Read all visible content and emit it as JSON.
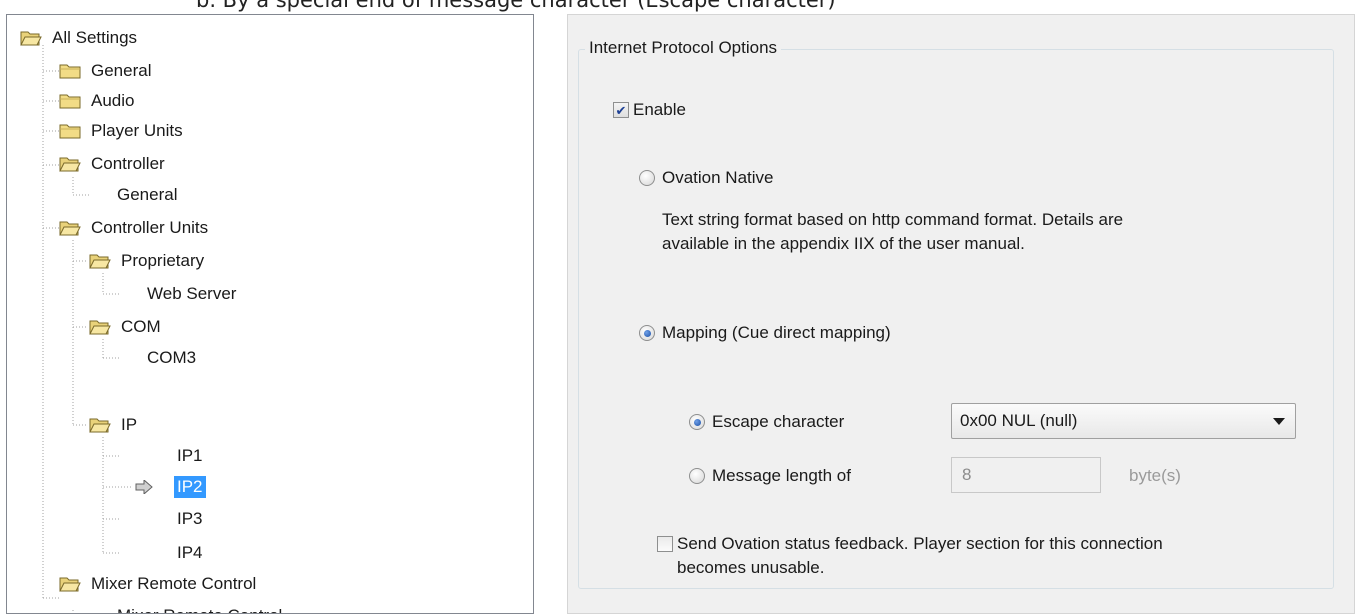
{
  "doc_heading": "b.   By a special end of message character (Escape character)",
  "tree": {
    "items": [
      {
        "label": "All Settings",
        "icon": "folder-open-icon"
      },
      {
        "label": "General",
        "icon": "folder-icon"
      },
      {
        "label": "Audio",
        "icon": "folder-icon"
      },
      {
        "label": "Player Units",
        "icon": "folder-icon"
      },
      {
        "label": "Controller",
        "icon": "folder-open-icon"
      },
      {
        "label": "General",
        "icon": "none"
      },
      {
        "label": "Controller Units",
        "icon": "folder-open-icon"
      },
      {
        "label": "Proprietary",
        "icon": "folder-open-icon"
      },
      {
        "label": "Web Server",
        "icon": "none"
      },
      {
        "label": "COM",
        "icon": "folder-open-icon"
      },
      {
        "label": "COM3",
        "icon": "none"
      },
      {
        "label": "IP",
        "icon": "folder-open-icon"
      },
      {
        "label": "IP1",
        "icon": "none"
      },
      {
        "label": "IP2",
        "icon": "none",
        "selected": true
      },
      {
        "label": "IP3",
        "icon": "none"
      },
      {
        "label": "IP4",
        "icon": "none"
      },
      {
        "label": "Mixer Remote Control",
        "icon": "folder-open-icon"
      },
      {
        "label": "Mixer Remote Control",
        "icon": "none"
      }
    ],
    "selection_color": "#3399ff",
    "current_marker_icon": "arrow-right-icon"
  },
  "settings": {
    "group_title": "Internet Protocol Options",
    "enable": {
      "label": "Enable",
      "checked": true
    },
    "ovation_native": {
      "label": "Ovation Native",
      "selected": false,
      "description_line1": "Text string format based on http command format. Details are",
      "description_line2": "available in the appendix IIX of the user manual."
    },
    "mapping": {
      "label": "Mapping (Cue direct mapping)",
      "selected": true
    },
    "escape_character": {
      "label": "Escape character",
      "selected": true,
      "value": "0x00 NUL (null)"
    },
    "message_length": {
      "label": "Message length of",
      "selected": false,
      "value": "8",
      "unit": "byte(s)"
    },
    "send_feedback": {
      "label_line1": "Send Ovation status feedback. Player section for this connection",
      "label_line2": "becomes unusable.",
      "checked": false
    }
  }
}
